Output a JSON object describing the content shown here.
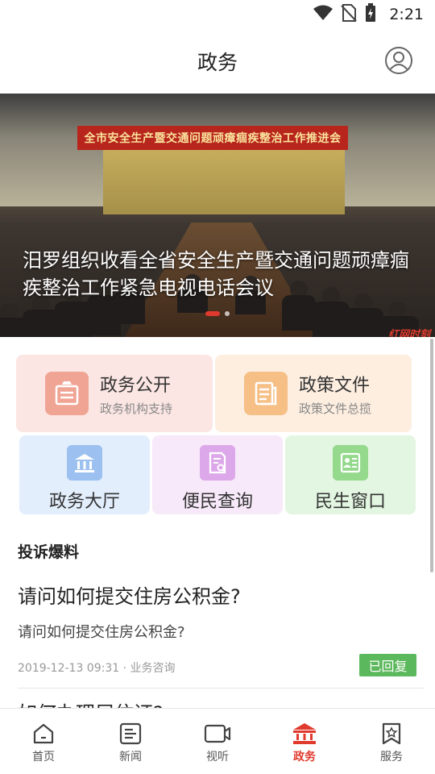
{
  "status_bar": {
    "time": "2:21",
    "icons": [
      "wifi-icon",
      "no-sim-icon",
      "battery-charging-icon"
    ]
  },
  "header": {
    "title": "政务",
    "profile_icon": "user-profile-icon"
  },
  "banner": {
    "board_text": "全市安全生产暨交通问题顽瘴痼疾整治工作推进会",
    "caption": "汨罗组织收看全省安全生产暨交通问题顽瘴痼疾整治工作紧急电视电话会议",
    "watermark": "红网时刻",
    "active_index": 0,
    "total": 2
  },
  "services": {
    "large": [
      {
        "title": "政务公开",
        "subtitle": "政务机构支持",
        "icon": "briefcase-icon",
        "bg": "#fbe6e3",
        "icon_bg": "#f0a494"
      },
      {
        "title": "政策文件",
        "subtitle": "政策文件总揽",
        "icon": "document-icon",
        "bg": "#fdeee0",
        "icon_bg": "#f6bf86"
      }
    ],
    "small": [
      {
        "title": "政务大厅",
        "icon": "building-icon",
        "bg": "#e3eefc",
        "icon_bg": "#9cc1f0"
      },
      {
        "title": "便民查询",
        "icon": "search-document-icon",
        "bg": "#f7e9f9",
        "icon_bg": "#dda8ea"
      },
      {
        "title": "民生窗口",
        "icon": "id-card-icon",
        "bg": "#e3f6e1",
        "icon_bg": "#94d98c"
      }
    ]
  },
  "complaints": {
    "section_title": "投诉爆料",
    "posts": [
      {
        "title": "请问如何提交住房公积金?",
        "description": "请问如何提交住房公积金?",
        "meta": "2019-12-13 09:31 · 业务咨询",
        "badge": "已回复",
        "badge_color": "#5cb85c"
      }
    ],
    "next_post_title": "如何办理居住证?"
  },
  "bottom_nav": {
    "items": [
      {
        "label": "首页",
        "icon": "home-icon"
      },
      {
        "label": "新闻",
        "icon": "news-icon"
      },
      {
        "label": "视听",
        "icon": "video-icon"
      },
      {
        "label": "政务",
        "icon": "government-icon"
      },
      {
        "label": "服务",
        "icon": "service-bookmark-icon"
      }
    ],
    "active": "政务",
    "active_color": "#e03a2e"
  }
}
